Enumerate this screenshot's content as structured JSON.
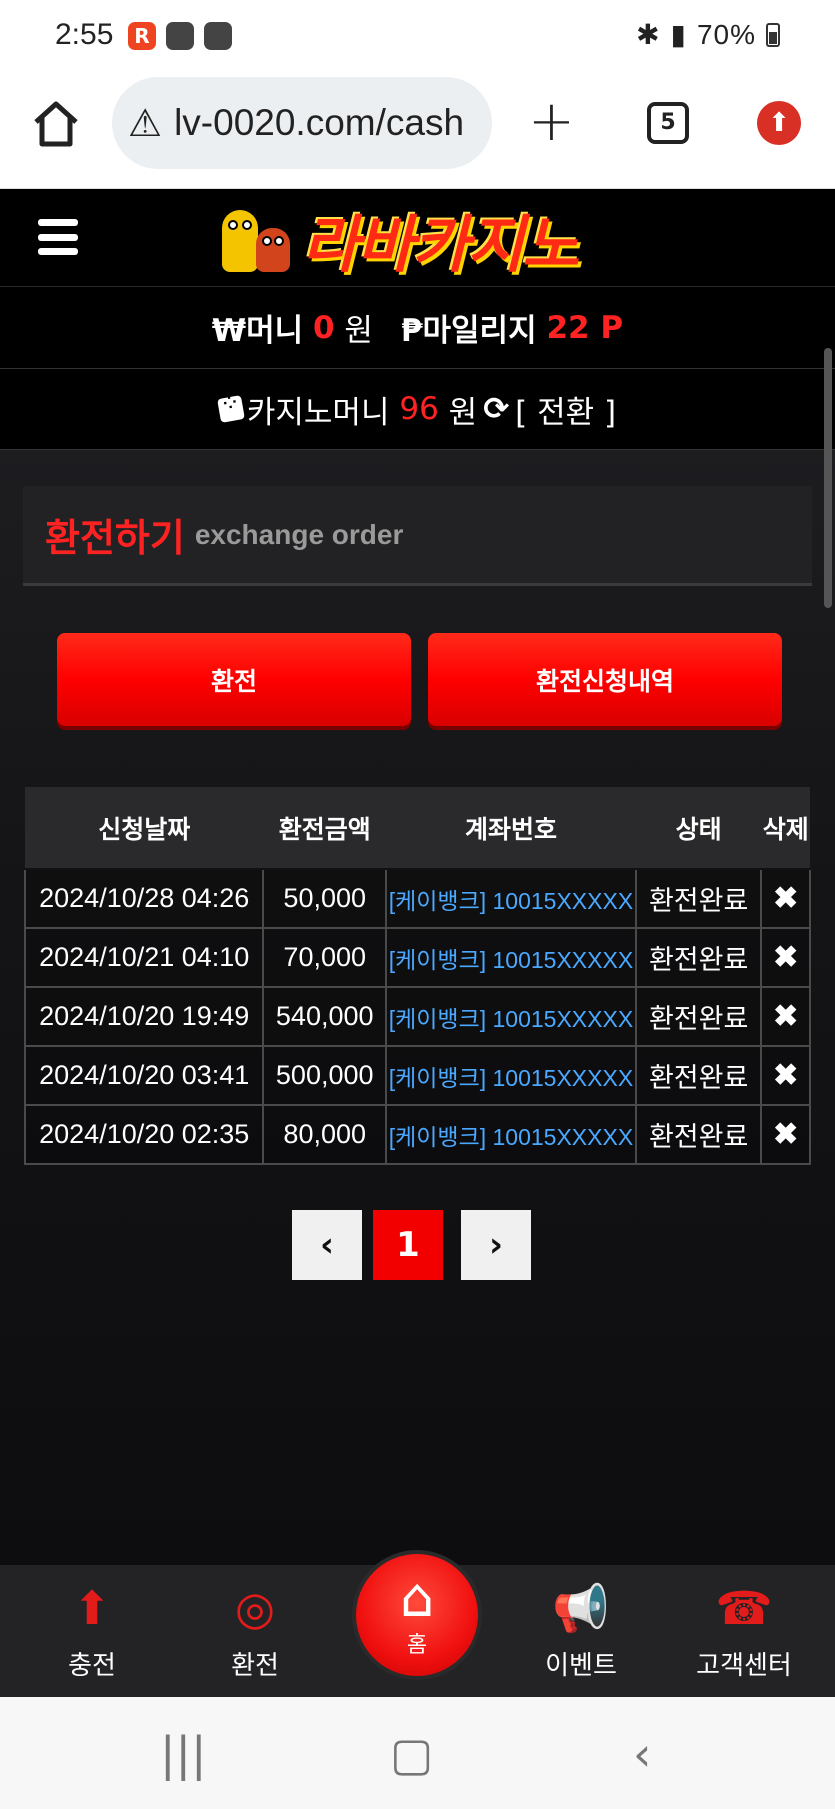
{
  "status_bar": {
    "time": "2:55",
    "system_text": "70%"
  },
  "browser": {
    "url": "lv-0020.com/cash",
    "tab_count": "5"
  },
  "site": {
    "logo_text": "라바카지노",
    "money_label": "₩머니",
    "money_value": "0",
    "money_unit": "원",
    "mileage_label": "₱마일리지",
    "mileage_value": "22 P",
    "casino_label": "카지노머니",
    "casino_value": "96",
    "casino_unit": "원",
    "swap_label": "[ 전환 ]"
  },
  "section": {
    "title_kr": "환전하기",
    "title_en": "exchange order"
  },
  "buttons": {
    "exchange": "환전",
    "history": "환전신청내역"
  },
  "table": {
    "headers": [
      "신청날짜",
      "환전금액",
      "계좌번호",
      "상태",
      "삭제"
    ],
    "rows": [
      {
        "date": "2024/10/28 04:26",
        "amount": "50,000",
        "account": "[케이뱅크] 10015XXXXX",
        "status": "환전완료",
        "delete": "✖"
      },
      {
        "date": "2024/10/21 04:10",
        "amount": "70,000",
        "account": "[케이뱅크] 10015XXXXX",
        "status": "환전완료",
        "delete": "✖"
      },
      {
        "date": "2024/10/20 19:49",
        "amount": "540,000",
        "account": "[케이뱅크] 10015XXXXX",
        "status": "환전완료",
        "delete": "✖"
      },
      {
        "date": "2024/10/20 03:41",
        "amount": "500,000",
        "account": "[케이뱅크] 10015XXXXX",
        "status": "환전완료",
        "delete": "✖"
      },
      {
        "date": "2024/10/20 02:35",
        "amount": "80,000",
        "account": "[케이뱅크] 10015XXXXX",
        "status": "환전완료",
        "delete": "✖"
      }
    ]
  },
  "pagination": {
    "prev": "‹",
    "current": "1",
    "next": "›"
  },
  "bottom_nav": {
    "charge": "충전",
    "exchange": "환전",
    "home": "홈",
    "event": "이벤트",
    "support": "고객센터"
  },
  "colors": {
    "accent_red": "#f20000",
    "account_blue": "#4aa8ff"
  }
}
